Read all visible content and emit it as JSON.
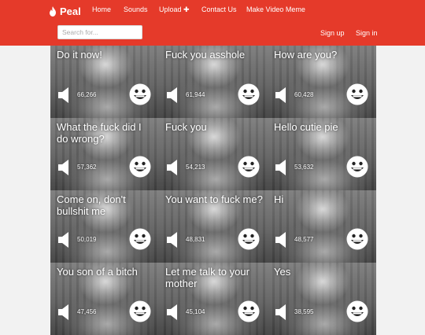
{
  "brand": {
    "name": "Peal",
    "icon": "flame-icon"
  },
  "nav": [
    {
      "label": "Home",
      "key": "home"
    },
    {
      "label": "Sounds",
      "key": "sounds"
    },
    {
      "label": "Upload ✚",
      "key": "upload"
    },
    {
      "label": "Contact Us",
      "key": "contact"
    },
    {
      "label": "Make Video Meme",
      "key": "make-video-meme"
    }
  ],
  "search": {
    "placeholder": "Search for...",
    "value": ""
  },
  "auth": {
    "signup": "Sign up",
    "signin": "Sign in"
  },
  "colors": {
    "header": "#e53a2a",
    "text_light": "#ffffff",
    "page_bg": "#f2f2f2"
  },
  "sounds": [
    {
      "title": "Do it now!",
      "plays": "66,266"
    },
    {
      "title": "Fuck you asshole",
      "plays": "61,944"
    },
    {
      "title": "How are you?",
      "plays": "60,428"
    },
    {
      "title": "What the fuck did I do wrong?",
      "plays": "57,362"
    },
    {
      "title": "Fuck you",
      "plays": "54,213"
    },
    {
      "title": "Hello cutie pie",
      "plays": "53,632"
    },
    {
      "title": "Come on, don't bullshit me",
      "plays": "50,019"
    },
    {
      "title": "You want to fuck me?",
      "plays": "48,831"
    },
    {
      "title": "Hi",
      "plays": "48,577"
    },
    {
      "title": "You son of a bitch",
      "plays": "47,456"
    },
    {
      "title": "Let me talk to your mother",
      "plays": "45,104"
    },
    {
      "title": "Yes",
      "plays": "38,595"
    }
  ]
}
